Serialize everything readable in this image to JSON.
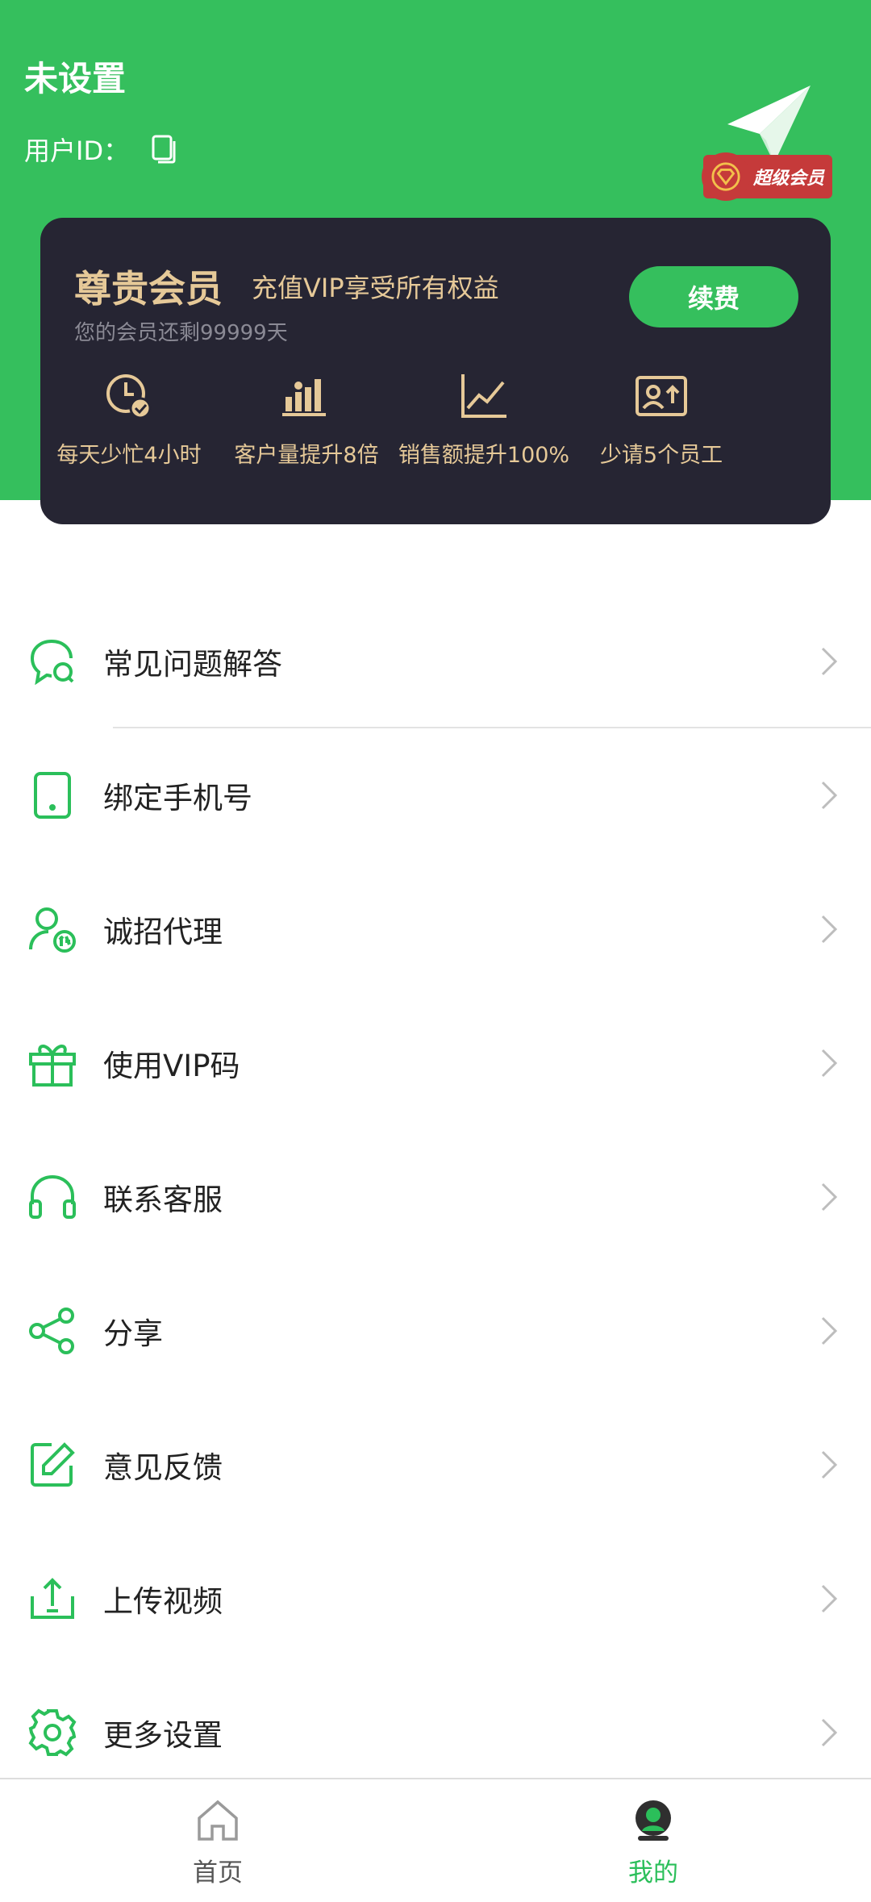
{
  "profile": {
    "name": "未设置",
    "id_label": "用户ID：",
    "badge": "超级会员"
  },
  "vip": {
    "title": "尊贵会员",
    "description": "充值VIP享受所有权益",
    "remaining": "您的会员还剩99999天",
    "renew_label": "续费",
    "benefits": [
      {
        "label": "每天少忙4小时",
        "icon": "clock-check-icon"
      },
      {
        "label": "客户量提升8倍",
        "icon": "bar-chart-icon"
      },
      {
        "label": "销售额提升100%",
        "icon": "line-chart-icon"
      },
      {
        "label": "少请5个员工",
        "icon": "id-card-icon"
      }
    ]
  },
  "menu": {
    "items": [
      {
        "label": "常见问题解答",
        "icon": "chat-bubble-icon"
      },
      {
        "label": "绑定手机号",
        "icon": "phone-icon"
      },
      {
        "label": "诚招代理",
        "icon": "agent-user-icon"
      },
      {
        "label": "使用VIP码",
        "icon": "gift-icon"
      },
      {
        "label": "联系客服",
        "icon": "headset-icon"
      },
      {
        "label": "分享",
        "icon": "share-icon"
      },
      {
        "label": "意见反馈",
        "icon": "edit-icon"
      },
      {
        "label": "上传视频",
        "icon": "upload-icon"
      },
      {
        "label": "更多设置",
        "icon": "gear-icon"
      }
    ]
  },
  "tabbar": {
    "home": "首页",
    "mine": "我的"
  },
  "colors": {
    "brand_green": "#35bf5d",
    "card_dark": "#262533",
    "gold_text": "#e6c998",
    "badge_red": "#c53a3a"
  }
}
